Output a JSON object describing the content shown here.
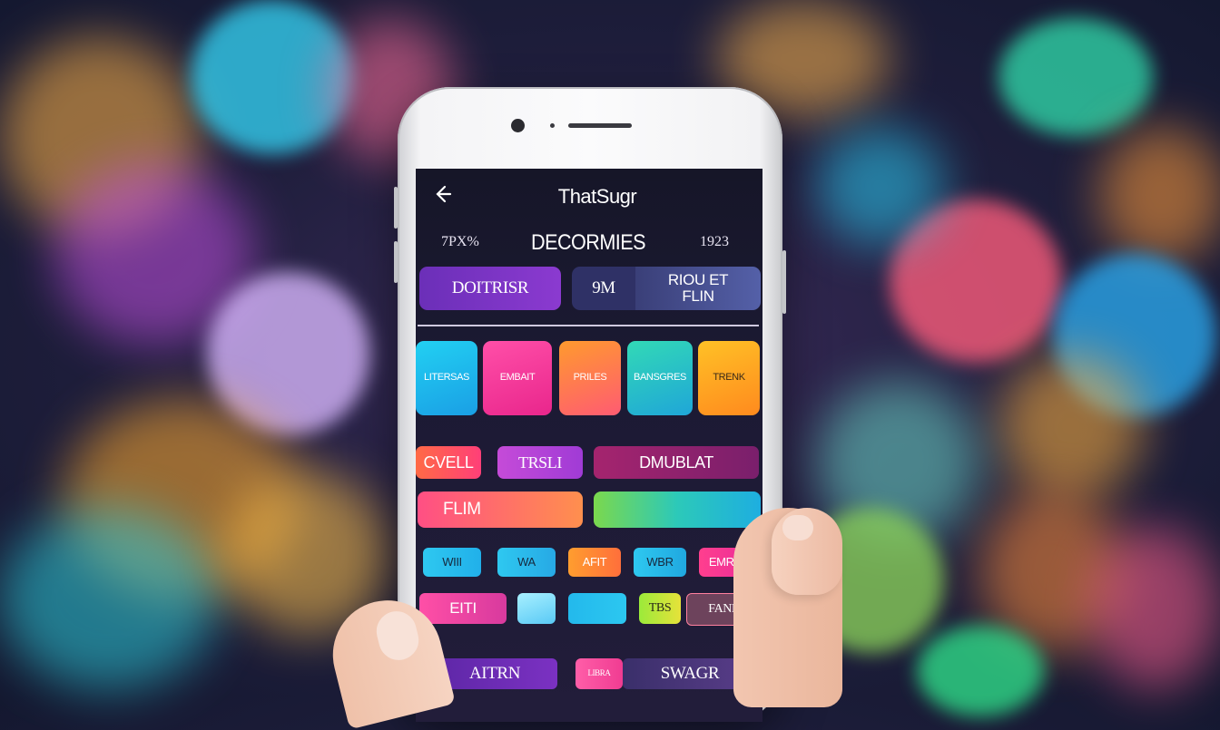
{
  "header": {
    "title": "ThatSugr",
    "left_meta": "7PX%",
    "center_meta": "DECORMIES",
    "right_meta": "1923"
  },
  "top_buttons": {
    "primary": "DOITRISR",
    "segment_left": "9M",
    "segment_right_line1": "RIOU ET",
    "segment_right_line2": "FLIN"
  },
  "tiles": [
    "LITERSAS",
    "EMBAIT",
    "PRILES",
    "BANSGRES",
    "TRENK"
  ],
  "row1": {
    "a": "CVELL",
    "b": "TRSLI",
    "c": "DMUBLAT"
  },
  "row_film": "FLIM",
  "row2": [
    "WIII",
    "WA",
    "AFIT",
    "WBR",
    "EMRES"
  ],
  "row3": {
    "a": "EITI",
    "b": "TBS",
    "c": "FAND"
  },
  "row4": {
    "a": "AITRN",
    "b": "LIBRA",
    "c": "SWAGR"
  },
  "colors": {
    "accent_purple": "#7b31c2",
    "accent_pink": "#ff4fa6",
    "accent_cyan": "#2ec8f0"
  }
}
